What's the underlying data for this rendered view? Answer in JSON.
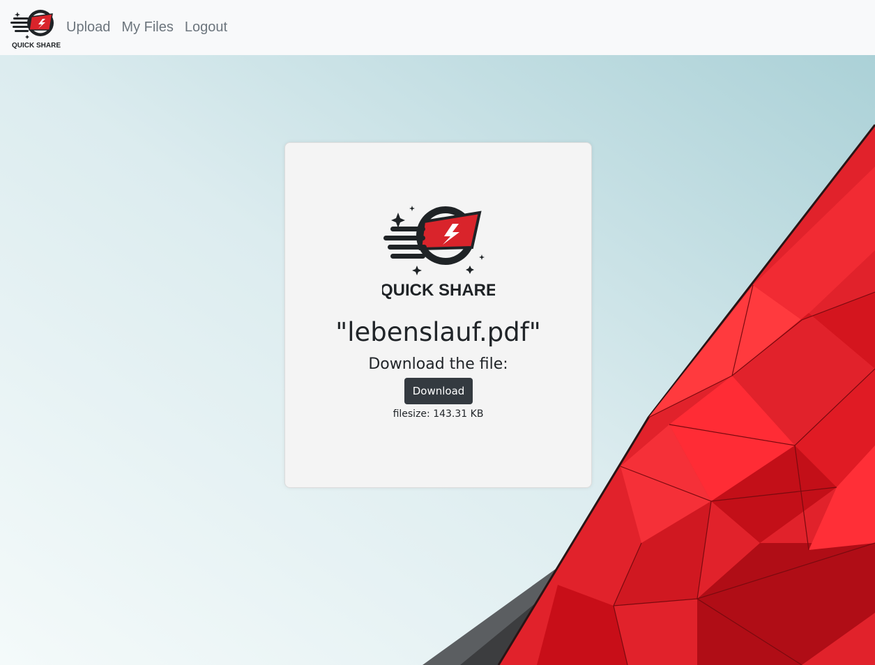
{
  "nav": {
    "logo_text": "QUICK SHARE",
    "links": [
      "Upload",
      "My Files",
      "Logout"
    ]
  },
  "card": {
    "logo_text": "QUICK SHARE",
    "file_title": "\"lebenslauf.pdf\"",
    "download_prompt": "Download the file:",
    "download_label": "Download",
    "filesize": "filesize: 143.31 KB"
  },
  "colors": {
    "accent": "#d9242b",
    "dark": "#1f2326",
    "navbar_bg": "#f8f9fa",
    "button_bg": "#343a40"
  }
}
